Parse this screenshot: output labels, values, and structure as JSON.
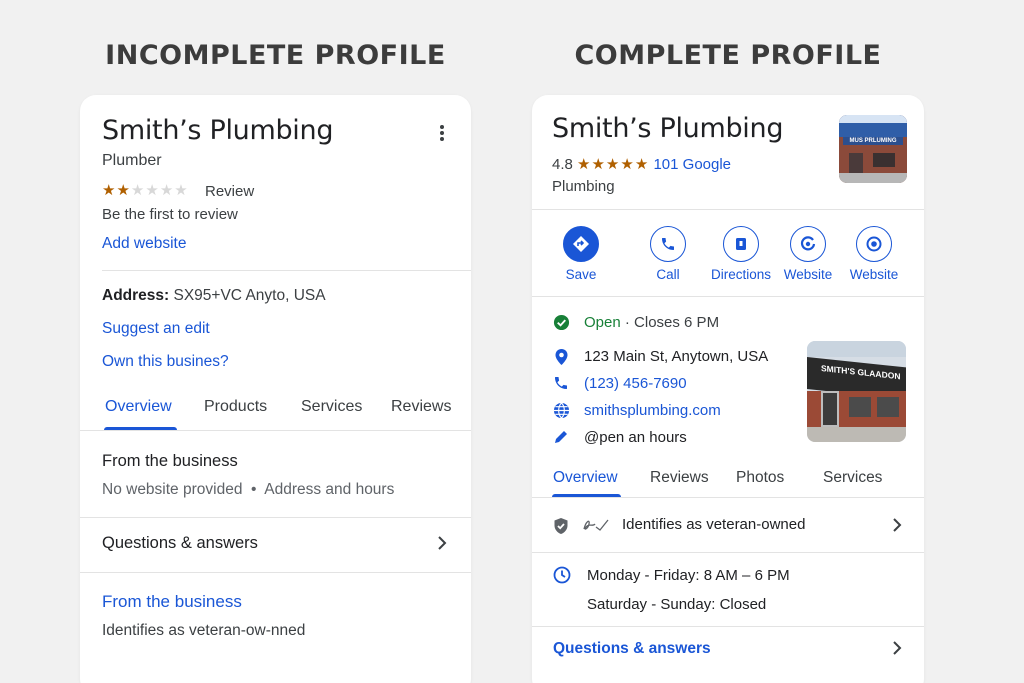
{
  "headings": {
    "left": "INCOMPLETE PROFILE",
    "right": "COMPLETE PROFILE"
  },
  "incomplete": {
    "name": "Smith’s Plumbing",
    "category": "Plumber",
    "rating_stars_filled": 2,
    "rating_stars_total": 6,
    "review_label": "Review",
    "first_review": "Be the first to review",
    "add_website": "Add website",
    "address_label": "Address:",
    "address_value": " SX95+VC Anyto, USA",
    "suggest_edit": "Suggest an edit",
    "own_business": "Own this busines?",
    "tabs": [
      "Overview",
      "Products",
      "Services",
      "Reviews"
    ],
    "from_business_title": "From the business",
    "from_business_text": "No website provided  •  Address and hours",
    "qa": "Questions & answers",
    "from_business_2": "From the business",
    "veteran": "Identifies as veteran-ow-nned"
  },
  "complete": {
    "name": "Smith’s Plumbing",
    "rating": "4.8",
    "review_count": "101",
    "review_source": "Google",
    "category": "Plumbing",
    "thumb_sign": "MUS PRLUMING",
    "actions": [
      {
        "label": "Save",
        "icon": "directions-diamond-icon"
      },
      {
        "label": "Call",
        "icon": "phone-icon"
      },
      {
        "label": "Directions",
        "icon": "badge-icon"
      },
      {
        "label": "Website",
        "icon": "website-icon"
      },
      {
        "label": "Website",
        "icon": "target-icon"
      }
    ],
    "open": "Open",
    "closes": " · Closes 6 PM",
    "address": "123 Main St, Anytown, USA",
    "phone": "(123) 456-7690",
    "website": "smithsplumbing.com",
    "hours_note": "@pen an hours",
    "photo_sign": "SMITH'S GLAADON",
    "tabs": [
      "Overview",
      "Reviews",
      "Photos",
      "Services"
    ],
    "veteran": "Identifies as veteran-owned",
    "hours_weekday": "Monday - Friday: 8 AM – 6 PM",
    "hours_weekend": "Saturday - Sunday: Closed",
    "qa": "Questions & answers"
  },
  "colors": {
    "accent": "#1a56d6",
    "open": "#188038",
    "star": "#b06000"
  }
}
